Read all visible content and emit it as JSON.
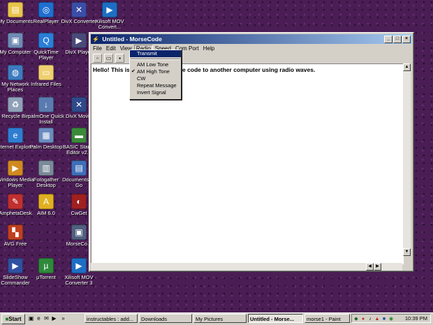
{
  "desktop": {
    "icons": [
      {
        "label": "My Documents",
        "icon": "folder-documents-icon",
        "color": "#e8c44a"
      },
      {
        "label": "RealPlayer",
        "icon": "realplayer-icon",
        "color": "#1f6fd0"
      },
      {
        "label": "DivX Converter",
        "icon": "divx-converter-icon",
        "color": "#3a4ea8"
      },
      {
        "label": "Xilisoft MOV Convert...",
        "icon": "xilisoft-icon",
        "color": "#1d6fc4"
      },
      {
        "label": "My Computer",
        "icon": "computer-icon",
        "color": "#6f8bb5"
      },
      {
        "label": "QuickTime Player",
        "icon": "quicktime-icon",
        "color": "#2a7ed8"
      },
      {
        "label": "DivX Player",
        "icon": "divx-player-icon",
        "color": "#4a4a7a"
      },
      {
        "label": "My Network Places",
        "icon": "network-icon",
        "color": "#3d7bbf"
      },
      {
        "label": "Infrared Files",
        "icon": "folder-icon",
        "color": "#f0d070"
      },
      {
        "label": "Recycle Bin",
        "icon": "recycle-bin-icon",
        "color": "#8fa0b8"
      },
      {
        "label": "palmOne Quick Install",
        "icon": "palm-install-icon",
        "color": "#5a7bb0"
      },
      {
        "label": "DivX Movie",
        "icon": "divx-movie-icon",
        "color": "#2e4a8a"
      },
      {
        "label": "Internet Explorer",
        "icon": "internet-explorer-icon",
        "color": "#2f7dd1"
      },
      {
        "label": "Palm Desktop",
        "icon": "palm-desktop-icon",
        "color": "#6b8cc0"
      },
      {
        "label": "BASIC Stamp Editor v2.2",
        "icon": "basic-stamp-icon",
        "color": "#3b8a3b"
      },
      {
        "label": "Windows Media Player",
        "icon": "media-player-icon",
        "color": "#d08a20"
      },
      {
        "label": "Fotogather Desktop",
        "icon": "fotogather-icon",
        "color": "#7a8a99"
      },
      {
        "label": "Documents To Go",
        "icon": "documents-to-go-icon",
        "color": "#3f6fb8"
      },
      {
        "label": "AmphetaDesk",
        "icon": "amphetadesk-icon",
        "color": "#c03030"
      },
      {
        "label": "AIM 6.0",
        "icon": "aim-icon",
        "color": "#e0b020"
      },
      {
        "label": "CwGet",
        "icon": "cwget-icon",
        "color": "#a02020"
      },
      {
        "label": "AVG Free",
        "icon": "avg-icon",
        "color": "#c04020"
      },
      {
        "label": "MorseCo...",
        "icon": "morsecode-icon",
        "color": "#506080"
      },
      {
        "label": "SlideShow Commander",
        "icon": "slideshow-icon",
        "color": "#3050a0"
      },
      {
        "label": "µTorrent",
        "icon": "utorrent-icon",
        "color": "#2e8a3a"
      },
      {
        "label": "Xilisoft MOV Converter 3",
        "icon": "xilisoft-converter-icon",
        "color": "#1d6fc4"
      }
    ]
  },
  "window": {
    "title": "Untitled - MorseCode",
    "menu": [
      "File",
      "Edit",
      "View",
      "Radio",
      "Speed",
      "Com Port",
      "Help"
    ],
    "open_menu": "Radio",
    "toolbar": [
      "new-file-icon",
      "open-folder-icon",
      "save-icon"
    ],
    "editor_text": "Hello! This is                            how to send morse code to another computer using radio waves."
  },
  "radio_menu": {
    "items": [
      {
        "label": "Transmit",
        "highlighted": true,
        "checked": false
      },
      {
        "label": "AM Low Tone",
        "checked": false
      },
      {
        "label": "AM High Tone",
        "checked": true
      },
      {
        "label": "CW",
        "checked": false
      },
      {
        "label": "Repeat Message",
        "checked": false
      },
      {
        "label": "Invert Signal",
        "checked": false
      }
    ]
  },
  "taskbar": {
    "start": "Start",
    "tasks": [
      {
        "label": "instructables : add...",
        "active": false
      },
      {
        "label": "Downloads",
        "active": false
      },
      {
        "label": "My Pictures",
        "active": false
      },
      {
        "label": "Untitled - Morse...",
        "active": true
      },
      {
        "label": "morse1 - Paint",
        "active": false
      }
    ],
    "clock": "10:39 PM"
  }
}
